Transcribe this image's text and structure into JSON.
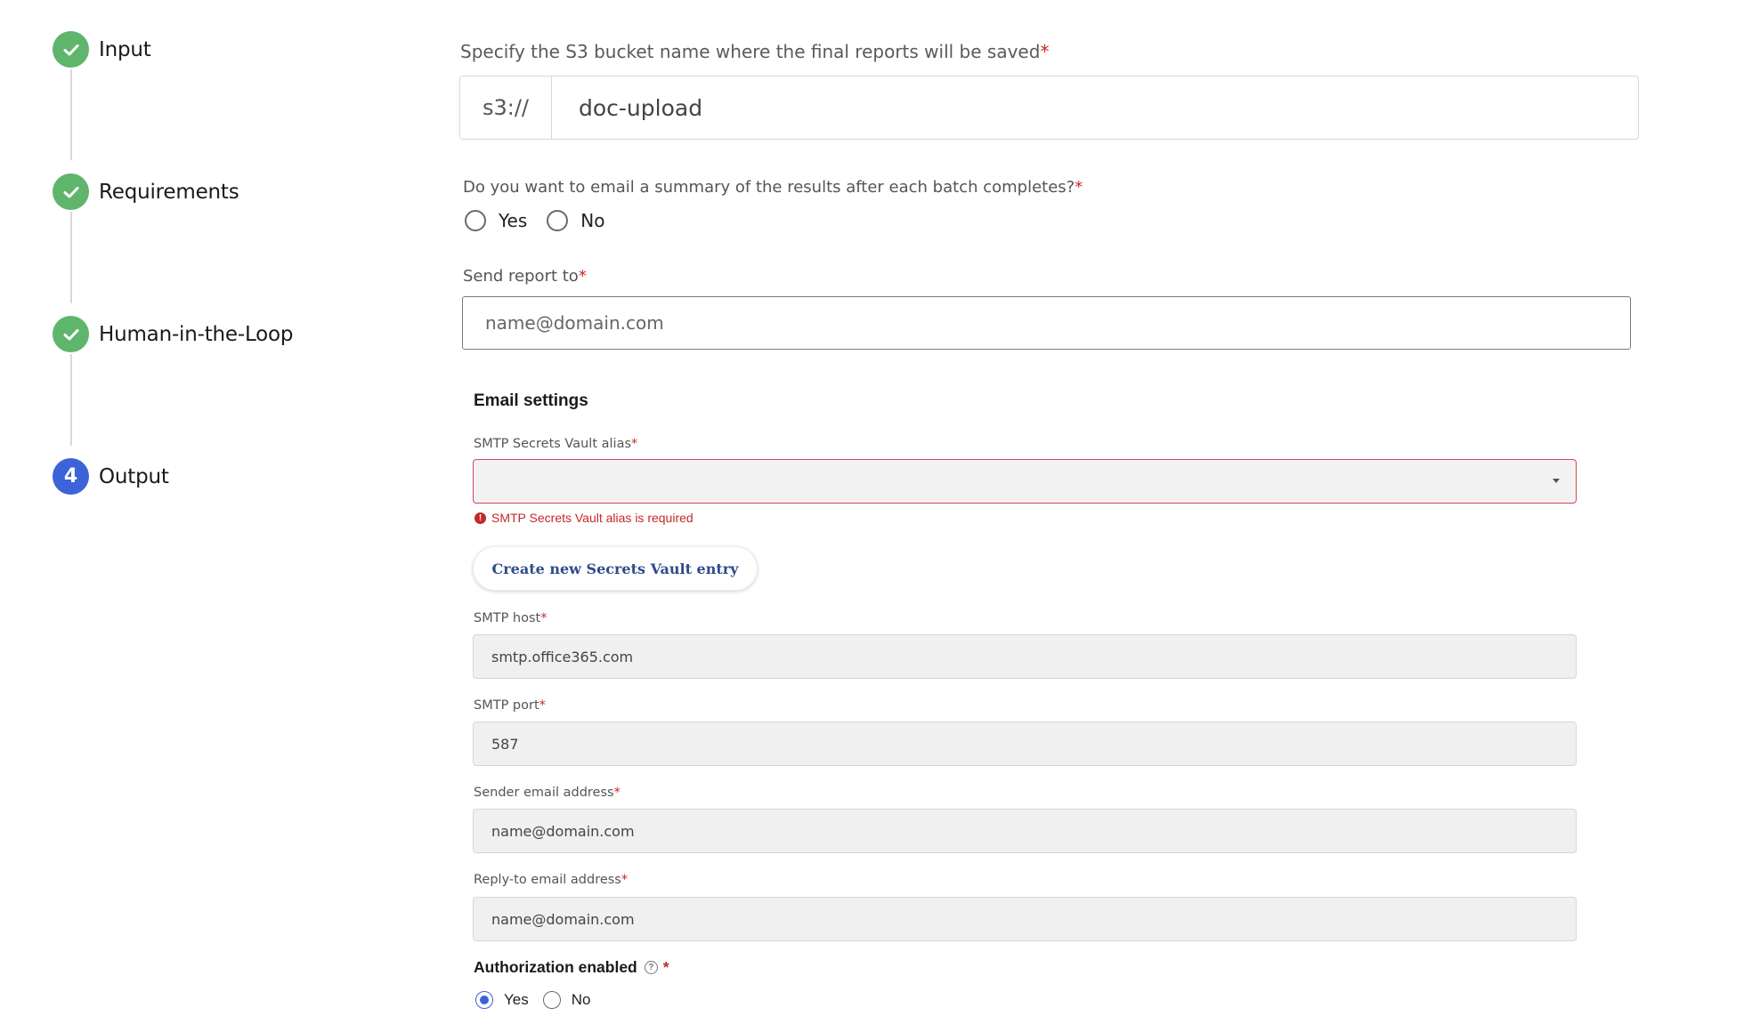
{
  "colors": {
    "step_done": "#5fb56c",
    "step_active": "#3c63d8",
    "required": "#c62828",
    "error": "#c62828",
    "button_text": "#2f4c8a"
  },
  "stepper": {
    "steps": [
      {
        "label": "Input",
        "status": "done",
        "icon": "check-icon"
      },
      {
        "label": "Requirements",
        "status": "done",
        "icon": "check-icon"
      },
      {
        "label": "Human-in-the-Loop",
        "status": "done",
        "icon": "check-icon"
      },
      {
        "label": "Output",
        "status": "active",
        "number": "4"
      }
    ]
  },
  "form": {
    "s3": {
      "label": "Specify the S3 bucket name where the final reports will be saved",
      "required_mark": "*",
      "prefix": "s3://",
      "value": "doc-upload"
    },
    "email_summary": {
      "label": "Do you want to email a summary of the results after each batch completes?",
      "required_mark": "*",
      "options": [
        "Yes",
        "No"
      ],
      "selected": null
    },
    "send_report": {
      "label": "Send report to",
      "required_mark": "*",
      "placeholder": "name@domain.com",
      "value": ""
    },
    "email_settings": {
      "title": "Email settings",
      "vault_alias": {
        "label": "SMTP Secrets Vault alias",
        "required_mark": "*",
        "value": "",
        "error": "SMTP Secrets Vault alias is required"
      },
      "create_vault_button": "Create new Secrets Vault entry",
      "smtp_host": {
        "label": "SMTP host",
        "required_mark": "*",
        "value": "smtp.office365.com"
      },
      "smtp_port": {
        "label": "SMTP port",
        "required_mark": "*",
        "value": "587"
      },
      "sender_email": {
        "label": "Sender email address",
        "required_mark": "*",
        "value": "name@domain.com"
      },
      "reply_to_email": {
        "label": "Reply-to email address",
        "required_mark": "*",
        "value": "name@domain.com"
      },
      "authorization": {
        "label": "Authorization enabled",
        "required_mark": "*",
        "options": [
          "Yes",
          "No"
        ],
        "selected": "Yes"
      }
    }
  }
}
